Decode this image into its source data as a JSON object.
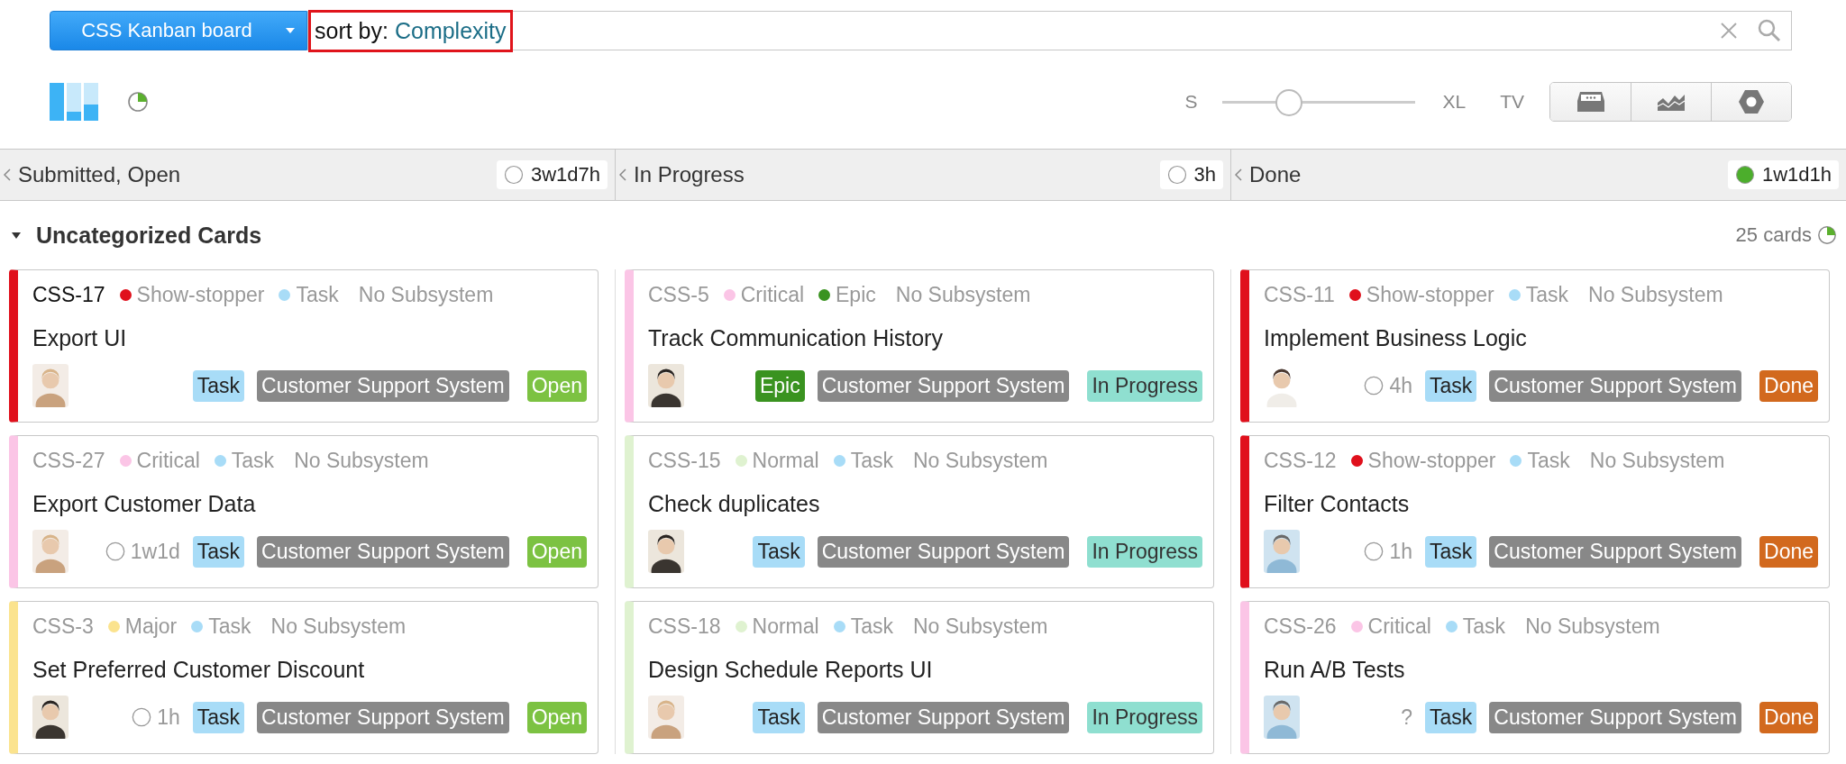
{
  "board_button": {
    "label": "CSS Kanban board"
  },
  "search": {
    "prefix": "sort by:",
    "value": "Complexity",
    "highlighted": true
  },
  "size_slider": {
    "labels": [
      "S",
      "XL",
      "TV"
    ],
    "level": 0.34
  },
  "columns": [
    {
      "title": "Submitted, Open",
      "total": "3w1d7h",
      "done": false,
      "cards": [
        {
          "id": "CSS-17",
          "selected": true,
          "priority": {
            "label": "Show-stopper",
            "color": "#e0101c"
          },
          "type": {
            "label": "Task",
            "color": "#a8dcf7"
          },
          "subsystem": "No Subsystem",
          "title": "Export UI",
          "tags": [
            {
              "label": "Task",
              "kind": "type"
            },
            {
              "label": "Customer Support System",
              "kind": "project"
            },
            {
              "label": "Open",
              "kind": "open"
            }
          ]
        },
        {
          "id": "CSS-27",
          "selected": false,
          "priority": {
            "label": "Critical",
            "color": "#fbc5e6"
          },
          "type": {
            "label": "Task",
            "color": "#a8dcf7"
          },
          "subsystem": "No Subsystem",
          "title": "Export Customer Data",
          "estimate": {
            "text": "1w1d",
            "clock": true
          },
          "tags": [
            {
              "label": "Task",
              "kind": "type"
            },
            {
              "label": "Customer Support System",
              "kind": "project"
            },
            {
              "label": "Open",
              "kind": "open"
            }
          ]
        },
        {
          "id": "CSS-3",
          "selected": false,
          "priority": {
            "label": "Major",
            "color": "#fbe38e"
          },
          "type": {
            "label": "Task",
            "color": "#a8dcf7"
          },
          "subsystem": "No Subsystem",
          "title": "Set Preferred Customer Discount",
          "estimate": {
            "text": "1h",
            "clock": true
          },
          "tags": [
            {
              "label": "Task",
              "kind": "type"
            },
            {
              "label": "Customer Support System",
              "kind": "project"
            },
            {
              "label": "Open",
              "kind": "open"
            }
          ]
        }
      ]
    },
    {
      "title": "In Progress",
      "total": "3h",
      "done": false,
      "cards": [
        {
          "id": "CSS-5",
          "selected": false,
          "priority": {
            "label": "Critical",
            "color": "#fbc5e6"
          },
          "type": {
            "label": "Epic",
            "color": "#3a9320"
          },
          "subsystem": "No Subsystem",
          "title": "Track Communication History",
          "tags": [
            {
              "label": "Epic",
              "kind": "epic"
            },
            {
              "label": "Customer Support System",
              "kind": "project"
            },
            {
              "label": "In Progress",
              "kind": "progress"
            }
          ]
        },
        {
          "id": "CSS-15",
          "selected": false,
          "priority": {
            "label": "Normal",
            "color": "#dff2d0"
          },
          "type": {
            "label": "Task",
            "color": "#a8dcf7"
          },
          "subsystem": "No Subsystem",
          "title": "Check duplicates",
          "tags": [
            {
              "label": "Task",
              "kind": "type"
            },
            {
              "label": "Customer Support System",
              "kind": "project"
            },
            {
              "label": "In Progress",
              "kind": "progress"
            }
          ]
        },
        {
          "id": "CSS-18",
          "selected": false,
          "priority": {
            "label": "Normal",
            "color": "#dff2d0"
          },
          "type": {
            "label": "Task",
            "color": "#a8dcf7"
          },
          "subsystem": "No Subsystem",
          "title": "Design Schedule Reports UI",
          "tags": [
            {
              "label": "Task",
              "kind": "type"
            },
            {
              "label": "Customer Support System",
              "kind": "project"
            },
            {
              "label": "In Progress",
              "kind": "progress"
            }
          ]
        }
      ]
    },
    {
      "title": "Done",
      "total": "1w1d1h",
      "done": true,
      "cards": [
        {
          "id": "CSS-11",
          "selected": false,
          "priority": {
            "label": "Show-stopper",
            "color": "#e0101c"
          },
          "type": {
            "label": "Task",
            "color": "#a8dcf7"
          },
          "subsystem": "No Subsystem",
          "title": "Implement Business Logic",
          "estimate": {
            "text": "4h",
            "clock": true
          },
          "tags": [
            {
              "label": "Task",
              "kind": "type"
            },
            {
              "label": "Customer Support System",
              "kind": "project"
            },
            {
              "label": "Done",
              "kind": "done"
            }
          ]
        },
        {
          "id": "CSS-12",
          "selected": false,
          "priority": {
            "label": "Show-stopper",
            "color": "#e0101c"
          },
          "type": {
            "label": "Task",
            "color": "#a8dcf7"
          },
          "subsystem": "No Subsystem",
          "title": "Filter Contacts",
          "estimate": {
            "text": "1h",
            "clock": true
          },
          "tags": [
            {
              "label": "Task",
              "kind": "type"
            },
            {
              "label": "Customer Support System",
              "kind": "project"
            },
            {
              "label": "Done",
              "kind": "done"
            }
          ]
        },
        {
          "id": "CSS-26",
          "selected": false,
          "priority": {
            "label": "Critical",
            "color": "#fbc5e6"
          },
          "type": {
            "label": "Task",
            "color": "#a8dcf7"
          },
          "subsystem": "No Subsystem",
          "title": "Run A/B Tests",
          "estimate": {
            "text": "?",
            "clock": false
          },
          "tags": [
            {
              "label": "Task",
              "kind": "type"
            },
            {
              "label": "Customer Support System",
              "kind": "project"
            },
            {
              "label": "Done",
              "kind": "done"
            }
          ]
        }
      ]
    }
  ],
  "group": {
    "title": "Uncategorized Cards",
    "expanded": true,
    "count": "25 cards"
  }
}
